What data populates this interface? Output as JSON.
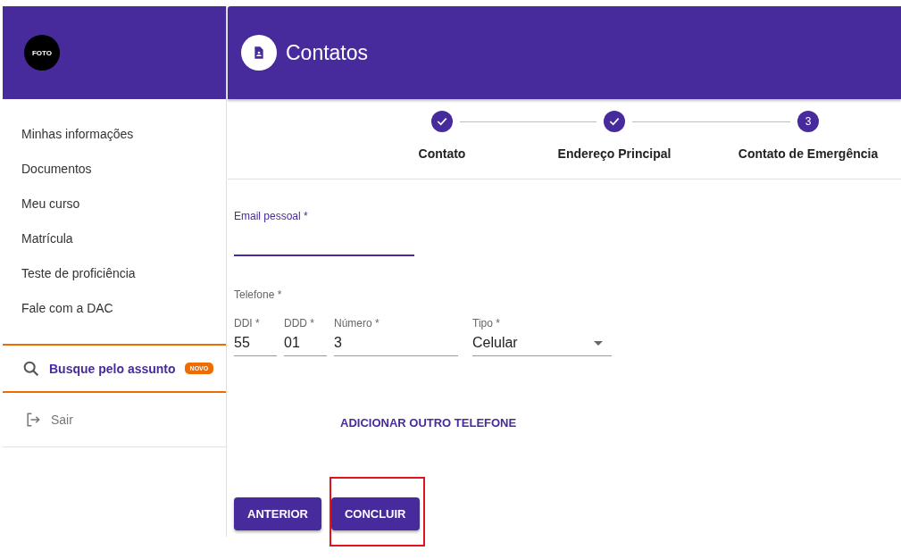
{
  "sidebar": {
    "photo_label": "FOTO",
    "items": [
      {
        "label": "Minhas informações"
      },
      {
        "label": "Documentos"
      },
      {
        "label": "Meu curso"
      },
      {
        "label": "Matrícula"
      },
      {
        "label": "Teste de proficiência"
      },
      {
        "label": "Fale com a DAC"
      }
    ],
    "search": {
      "label": "Busque pelo assunto",
      "badge": "NOVO"
    },
    "logout": {
      "label": "Sair"
    }
  },
  "header": {
    "title": "Contatos"
  },
  "steps": [
    {
      "label": "Contato",
      "completed": true
    },
    {
      "label": "Endereço Principal",
      "completed": true
    },
    {
      "label": "Contato de Emergência",
      "completed": false,
      "number": "3"
    }
  ],
  "email": {
    "label": "Email pessoal *",
    "focused": true
  },
  "phone": {
    "title": "Telefone *",
    "fields": [
      {
        "kind": "input",
        "label": "DDI *",
        "value": "55"
      },
      {
        "kind": "input",
        "label": "DDD *",
        "value": "01"
      },
      {
        "kind": "input",
        "label": "Número *",
        "value": "3"
      },
      {
        "kind": "select",
        "label": "Tipo *",
        "value": "Celular"
      }
    ]
  },
  "add_phone": "ADICIONAR OUTRO TELEFONE",
  "buttons": [
    {
      "label": "ANTERIOR",
      "highlighted": false
    },
    {
      "label": "CONCLUIR",
      "highlighted": true
    }
  ]
}
